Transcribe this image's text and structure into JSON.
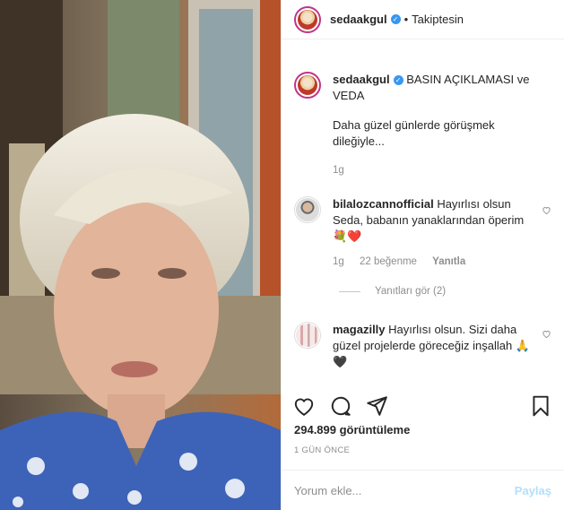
{
  "post": {
    "username": "sedaakgul",
    "verified_badge": "✓",
    "dot": "•",
    "follow_state": "Takiptesin"
  },
  "caption": {
    "username": "sedaakgul",
    "text": "BASIN AÇIKLAMASI ve VEDA",
    "body": "Daha güzel günlerde görüşmek dileğiyle...",
    "time": "1g"
  },
  "comments": [
    {
      "username": "bilalozcannofficial",
      "text": "Hayırlısı olsun Seda, babanın yanaklarından öperim 💐❤️",
      "time": "1g",
      "likes": "22 beğenme",
      "reply": "Yanıtla",
      "view_replies": "Yanıtları gör (2)"
    },
    {
      "username": "magazilly",
      "text": "Hayırlısı olsun. Sizi daha güzel projelerde göreceğiz inşallah 🙏🖤"
    }
  ],
  "actions": {
    "like_icon": "heart-icon",
    "comment_icon": "comment-icon",
    "share_icon": "share-icon",
    "save_icon": "bookmark-icon"
  },
  "stats": {
    "views": "294.899 görüntüleme",
    "posted": "1 GÜN ÖNCE"
  },
  "add_comment": {
    "placeholder": "Yorum ekle...",
    "post_label": "Paylaş"
  },
  "colors": {
    "accent": "#3897f0",
    "post_disabled": "#b2dffc",
    "muted": "#8e8e8e"
  }
}
